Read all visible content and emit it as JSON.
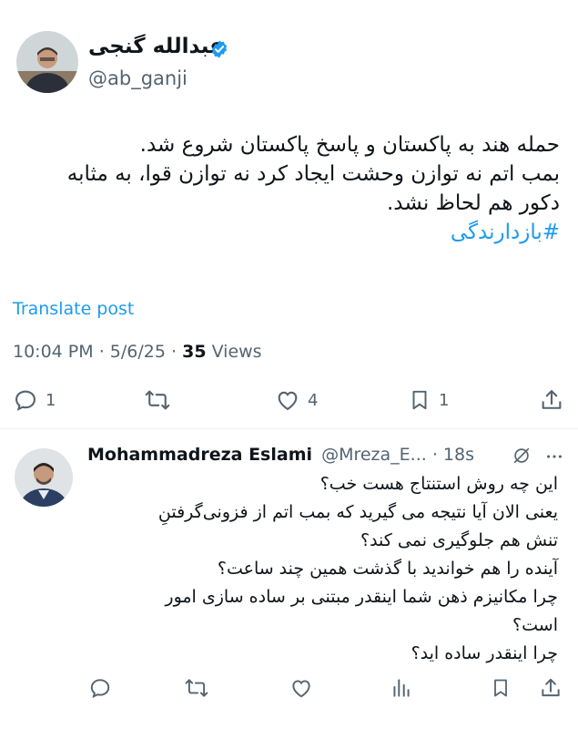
{
  "tweet": {
    "author_name": "عبدالله گنجی",
    "author_handle": "@ab_ganji",
    "lines": [
      "حمله هند به پاکستان و پاسخ پاکستان شروع شد.",
      "بمب اتم نه توازن وحشت ایجاد کرد نه توازن قوا، به مثابه",
      "دکور هم لحاظ نشد."
    ],
    "hashtag": "#بازدارندگی",
    "translate_label": "Translate post",
    "time": "10:04 PM",
    "date": "5/6/25",
    "views_count": "35",
    "views_label": "Views",
    "separator": "·",
    "actions": {
      "reply_count": "1",
      "like_count": "4",
      "bookmark_count": "1"
    }
  },
  "reply": {
    "author_name": "Mohammadreza Eslami",
    "author_handle": "@Mreza_E...",
    "separator": "·",
    "time": "18s",
    "lines": [
      "این چه روش استنتاج هست خب؟",
      "یعنی الان آیا نتیجه می گیرید که بمب اتم از فزونی‌گرفتنِ",
      "تنش هم جلوگیری نمی کند؟",
      "آینده را هم خواندید با گذشت همین چند ساعت؟",
      "چرا مکانیزم ذهن شما اینقدر مبتنی بر ساده سازی امور",
      "است؟",
      "چرا اینقدر ساده اید؟"
    ]
  },
  "colors": {
    "accent": "#1d9bf0",
    "text": "#0f1419",
    "muted": "#536471"
  },
  "icons": {
    "verified": "verified-badge-icon",
    "reply": "reply-icon",
    "repost": "repost-icon",
    "like": "like-icon",
    "bookmark": "bookmark-icon",
    "share": "share-icon",
    "views": "views-icon",
    "grok": "grok-icon",
    "more": "more-icon"
  }
}
